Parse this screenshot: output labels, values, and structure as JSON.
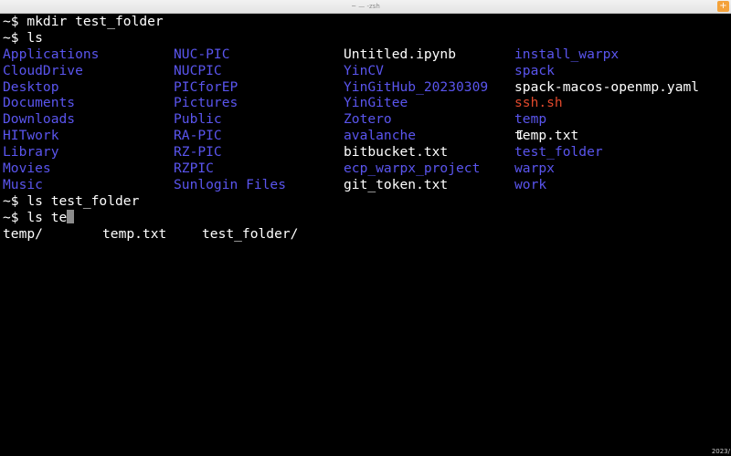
{
  "window": {
    "title": "~ — -zsh",
    "new_tab_label": "+",
    "clock": "2023/"
  },
  "terminal": {
    "lines": [
      "~$ mkdir test_folder",
      "~$ ls"
    ],
    "ls_columns": [
      [
        {
          "name": "Applications",
          "kind": "dir"
        },
        {
          "name": "CloudDrive",
          "kind": "dir"
        },
        {
          "name": "Desktop",
          "kind": "dir"
        },
        {
          "name": "Documents",
          "kind": "dir"
        },
        {
          "name": "Downloads",
          "kind": "dir"
        },
        {
          "name": "HITwork",
          "kind": "dir"
        },
        {
          "name": "Library",
          "kind": "dir"
        },
        {
          "name": "Movies",
          "kind": "dir"
        },
        {
          "name": "Music",
          "kind": "dir"
        }
      ],
      [
        {
          "name": "NUC-PIC",
          "kind": "dir"
        },
        {
          "name": "NUCPIC",
          "kind": "dir"
        },
        {
          "name": "PICforEP",
          "kind": "dir"
        },
        {
          "name": "Pictures",
          "kind": "dir"
        },
        {
          "name": "Public",
          "kind": "dir"
        },
        {
          "name": "RA-PIC",
          "kind": "dir"
        },
        {
          "name": "RZ-PIC",
          "kind": "dir"
        },
        {
          "name": "RZPIC",
          "kind": "dir"
        },
        {
          "name": "Sunlogin Files",
          "kind": "dir"
        }
      ],
      [
        {
          "name": "Untitled.ipynb",
          "kind": "file"
        },
        {
          "name": "YinCV",
          "kind": "dir"
        },
        {
          "name": "YinGitHub_20230309",
          "kind": "dir"
        },
        {
          "name": "YinGitee",
          "kind": "dir"
        },
        {
          "name": "Zotero",
          "kind": "dir"
        },
        {
          "name": "avalanche",
          "kind": "dir"
        },
        {
          "name": "bitbucket.txt",
          "kind": "file"
        },
        {
          "name": "ecp_warpx_project",
          "kind": "dir"
        },
        {
          "name": "git_token.txt",
          "kind": "file"
        }
      ],
      [
        {
          "name": "install_warpx",
          "kind": "dir"
        },
        {
          "name": "spack",
          "kind": "dir"
        },
        {
          "name": "spack-macos-openmp.yaml",
          "kind": "file"
        },
        {
          "name": "ssh.sh",
          "kind": "exe"
        },
        {
          "name": "temp",
          "kind": "dir"
        },
        {
          "name": "temp.txt",
          "kind": "file"
        },
        {
          "name": "test_folder",
          "kind": "dir"
        },
        {
          "name": "warpx",
          "kind": "dir"
        },
        {
          "name": "work",
          "kind": "dir"
        }
      ]
    ],
    "after_lines": [
      "~$ ls test_folder"
    ],
    "current_prompt": "~$ ls te",
    "completions": [
      {
        "name": "temp/"
      },
      {
        "name": "temp.txt"
      },
      {
        "name": "test_folder/"
      }
    ]
  },
  "colors": {
    "background": "#000000",
    "text": "#ffffff",
    "directory": "#5a55ee",
    "executable": "#e2492c",
    "cursor": "#8c8c8c"
  }
}
